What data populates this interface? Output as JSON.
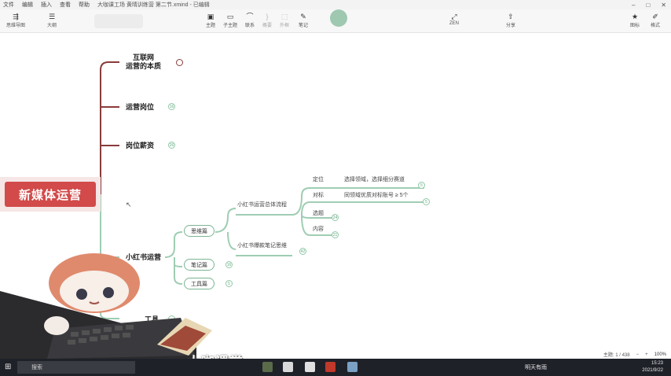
{
  "menu": {
    "items": [
      "文件",
      "编辑",
      "插入",
      "查看",
      "帮助"
    ],
    "doc_title": "大咖课工场 黄晴训练营 第二节.xmind - 已编辑"
  },
  "toolbar": {
    "left": [
      {
        "label": "思维导图"
      },
      {
        "label": "大纲"
      }
    ],
    "tools": [
      {
        "label": "主题"
      },
      {
        "label": "子主题"
      },
      {
        "label": "联系"
      },
      {
        "label": "概要"
      },
      {
        "label": "外框"
      },
      {
        "label": "笔记"
      }
    ],
    "zen_label": "ZEN",
    "share_label": "分享",
    "right": [
      {
        "label": "图标"
      },
      {
        "label": "格式"
      }
    ]
  },
  "mindmap": {
    "central": "新媒体运营",
    "branches": [
      {
        "label_line1": "互联网",
        "label_line2": "运营的本质",
        "badge": ""
      },
      {
        "label": "运营岗位",
        "badge": "16"
      },
      {
        "label": "岗位薪资",
        "badge": "26"
      },
      {
        "label": "小红书运营"
      },
      {
        "label": "工具",
        "badge": ""
      }
    ],
    "sub_nodes": [
      "思维篇",
      "笔记篇",
      "工具篇"
    ],
    "sub_badges": {
      "notes": "16",
      "tools": "5"
    },
    "mid": {
      "flow": "小红书运营总体流程",
      "notes": "小红书爆款笔记思维",
      "notes_badge": "42"
    },
    "leaves": [
      {
        "label": "定位",
        "detail": "选择领域，选择细分赛道",
        "badge": "5"
      },
      {
        "label": "对标",
        "detail": "同领域优质对标账号 ≥ 5个",
        "badge": "5"
      },
      {
        "label": "选题",
        "badge": "24"
      },
      {
        "label": "内容",
        "badge": "21"
      }
    ]
  },
  "status": {
    "topic_count": "主题: 1 / 438",
    "zoom": "100%"
  },
  "watermark": "大咖课堂",
  "taskbar": {
    "search_placeholder": "搜索",
    "weather": "明天有雨",
    "time": "15:23",
    "date": "2021/9/22"
  },
  "colors": {
    "central_fill": "#d24a4a",
    "branch_line": "#8a3b3b",
    "sub_line": "#9fcdb3",
    "taskbar": "#1f2129"
  }
}
